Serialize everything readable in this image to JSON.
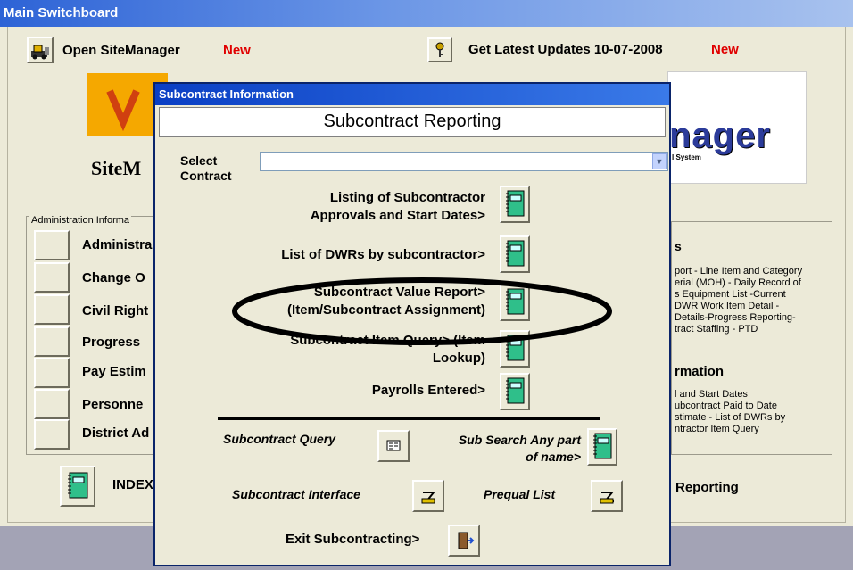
{
  "main_window": {
    "title": "Main Switchboard",
    "open_sitemanager": {
      "label": "Open SiteManager",
      "badge": "New"
    },
    "get_updates": {
      "label": "Get Latest Updates 10-07-2008",
      "badge": "New"
    },
    "logo_left_text": "SiteM",
    "logo_right_text": "nager",
    "logo_right_sub": "l System",
    "admin_group": {
      "title": "Administration Informa",
      "items": [
        "Administra",
        "Change O",
        "Civil Right",
        "Progress",
        "Pay Estim",
        "Personne",
        "District Ad"
      ]
    },
    "right_group": {
      "heading1": "s",
      "text1": [
        "port - Line Item and Category",
        "erial (MOH) - Daily Record of",
        "s Equipment List -Current",
        "DWR Work Item Detail -",
        "Details-Progress Reporting-",
        "tract Staffing - PTD"
      ],
      "heading2": "rmation",
      "text2": [
        "l and Start Dates",
        "ubcontract Paid to Date",
        "stimate  - List of DWRs by",
        "ntractor Item Query"
      ]
    },
    "index_label": "INDEX",
    "reporting_label": "Reporting"
  },
  "dialog": {
    "title": "Subcontract Information",
    "header": "Subcontract Reporting",
    "select_label": "Select Contract",
    "select_value": "",
    "reports": [
      {
        "label": "Listing of Subcontractor Approvals and Start Dates>"
      },
      {
        "label": "List of DWRs by subcontractor>"
      },
      {
        "label": "Subcontract Value Report> (Item/Subcontract Assignment)"
      },
      {
        "label": "Subcontract Item Query> (Item Lookup)"
      },
      {
        "label": "Payrolls Entered>"
      }
    ],
    "subcontract_query": "Subcontract Query",
    "sub_search": "Sub Search Any part of name>",
    "subcontract_interface": "Subcontract Interface",
    "prequal_list": "Prequal List",
    "exit_label": "Exit Subcontracting>"
  },
  "colors": {
    "title_bar": "#2d63d6",
    "new_badge": "#e00000",
    "window_bg": "#ecead8",
    "highlight_ellipse": "#000000"
  }
}
